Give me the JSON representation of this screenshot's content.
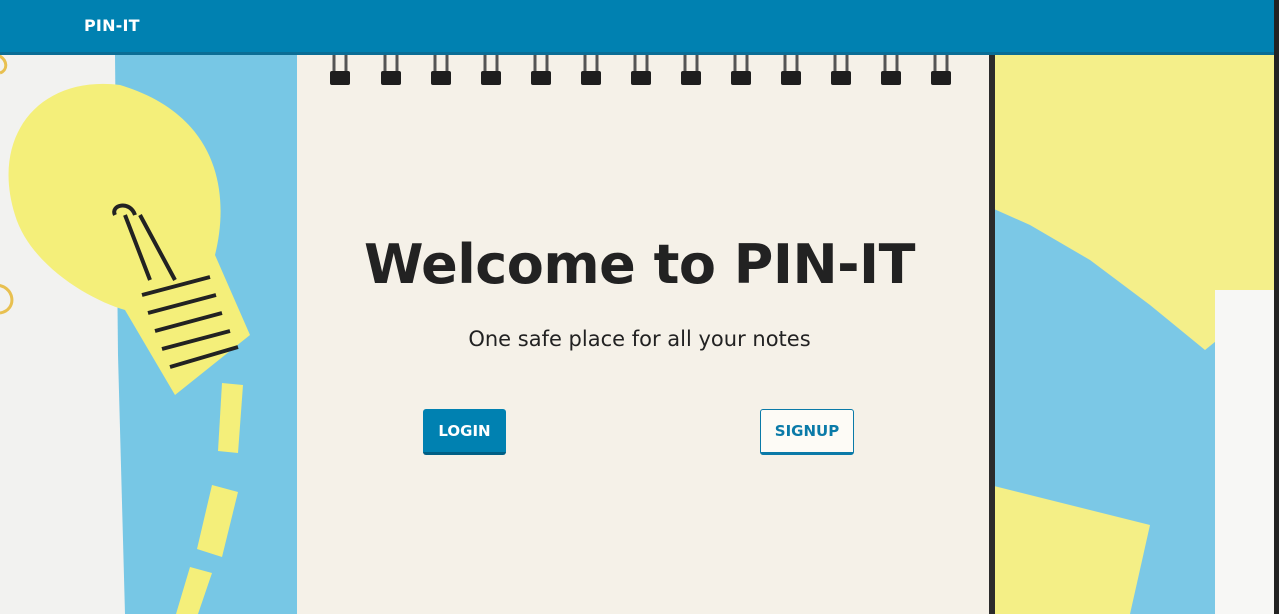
{
  "navbar": {
    "brand": "PIN-IT"
  },
  "hero": {
    "title": "Welcome to PIN-IT",
    "subtitle": "One safe place for all your notes",
    "login_label": "LOGIN",
    "signup_label": "SIGNUP"
  },
  "colors": {
    "primary": "#0081b1",
    "notebook": "#f5f1e8",
    "paper_blue": "#77c7e5",
    "sticky_yellow": "#f4ef86"
  }
}
